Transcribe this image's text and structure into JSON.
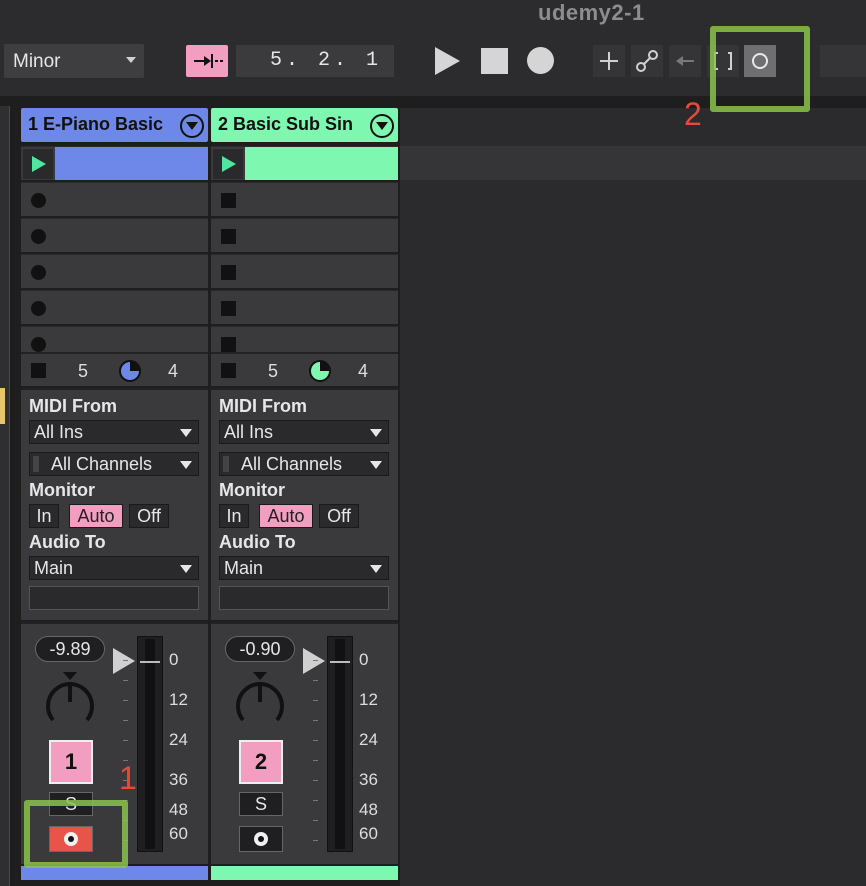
{
  "window": {
    "title": "udemy2-1"
  },
  "transport": {
    "scale": "Minor",
    "position": "5. 2. 1"
  },
  "tracks": [
    {
      "name": "1 E-Piano Basic",
      "color": "#6d88e8",
      "clip_color": "#6d88e8",
      "stop_row": {
        "left": "5",
        "right": "4"
      },
      "io": {
        "midi_from_label": "MIDI From",
        "midi_from": "All Ins",
        "channel": "All Channels",
        "monitor_label": "Monitor",
        "monitor_in": "In",
        "monitor_auto": "Auto",
        "monitor_off": "Off",
        "audio_to_label": "Audio To",
        "audio_to": "Main"
      },
      "mixer": {
        "volume": "-9.89",
        "number": "1",
        "solo": "S",
        "armed": true,
        "arm_color": "#e8544a"
      }
    },
    {
      "name": "2 Basic Sub Sin",
      "color": "#7ef7b0",
      "clip_color": "#7ef7b0",
      "stop_row": {
        "left": "5",
        "right": "4"
      },
      "io": {
        "midi_from_label": "MIDI From",
        "midi_from": "All Ins",
        "channel": "All Channels",
        "monitor_label": "Monitor",
        "monitor_in": "In",
        "monitor_auto": "Auto",
        "monitor_off": "Off",
        "audio_to_label": "Audio To",
        "audio_to": "Main"
      },
      "mixer": {
        "volume": "-0.90",
        "number": "2",
        "solo": "S",
        "armed": false,
        "arm_color": "#1f1f21"
      }
    }
  ],
  "meter_scale": [
    "0",
    "12",
    "24",
    "36",
    "48",
    "60"
  ],
  "annotations": {
    "mark_1": "1",
    "mark_2": "2",
    "color": "#8bc34a",
    "number_color": "#e64a3a"
  }
}
